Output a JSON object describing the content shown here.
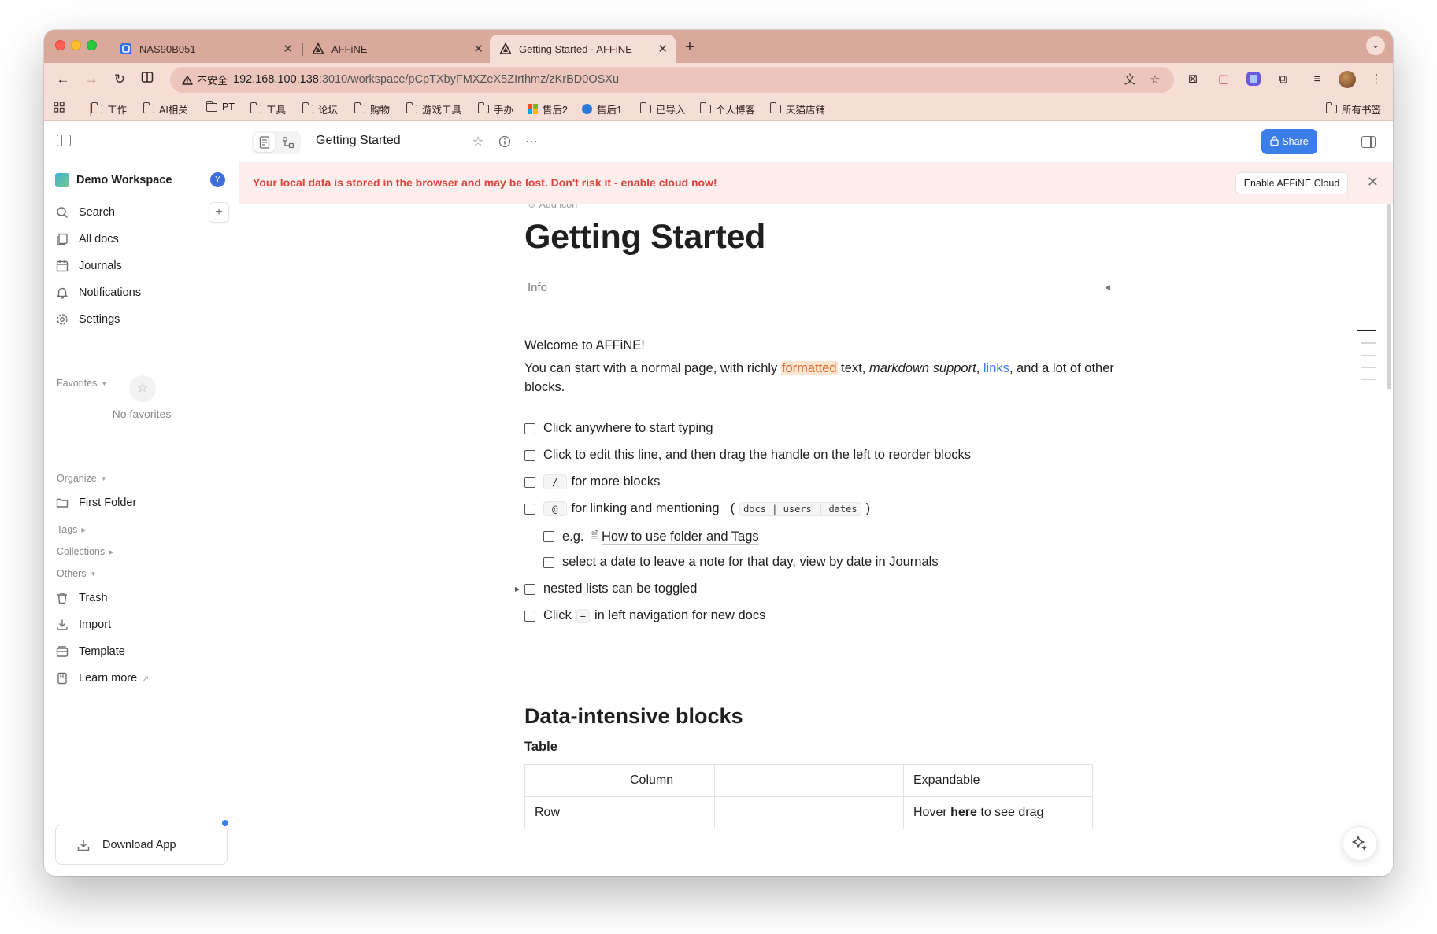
{
  "browser": {
    "tabs": [
      {
        "title": "NAS90B051",
        "favicon": "nas-favicon",
        "active": false
      },
      {
        "title": "AFFiNE",
        "favicon": "affine-favicon",
        "active": false
      },
      {
        "title": "Getting Started · AFFiNE",
        "favicon": "affine-favicon",
        "active": true
      }
    ],
    "security_label": "不安全",
    "url_host": "192.168.100.138",
    "url_rest": ":3010/workspace/pCpTXbyFMXZeX5ZIrthmz/zKrBD0OSXu",
    "bookmarks": [
      "工作",
      "AI相关",
      "PT",
      "工具",
      "论坛",
      "购物",
      "游戏工具",
      "手办",
      "售后2",
      "售后1",
      "已导入",
      "个人博客",
      "天猫店铺"
    ],
    "all_bookmarks": "所有书签",
    "theme_color": "#d9a99c"
  },
  "sidebar": {
    "workspace_name": "Demo Workspace",
    "workspace_avatar": "Y",
    "nav": [
      {
        "label": "Search",
        "icon": "search-icon"
      },
      {
        "label": "All docs",
        "icon": "docs-icon"
      },
      {
        "label": "Journals",
        "icon": "calendar-icon"
      },
      {
        "label": "Notifications",
        "icon": "bell-icon"
      },
      {
        "label": "Settings",
        "icon": "gear-icon"
      }
    ],
    "favorites_label": "Favorites",
    "no_favorites": "No favorites",
    "organize_label": "Organize",
    "folders": [
      "First Folder"
    ],
    "tags_label": "Tags",
    "collections_label": "Collections",
    "others_label": "Others",
    "others": [
      {
        "label": "Trash",
        "icon": "trash-icon"
      },
      {
        "label": "Import",
        "icon": "import-icon"
      },
      {
        "label": "Template",
        "icon": "template-icon"
      },
      {
        "label": "Learn more",
        "icon": "book-icon"
      }
    ],
    "download_label": "Download App"
  },
  "header": {
    "title": "Getting Started",
    "share_label": "Share",
    "accent_color": "#3c7ee8"
  },
  "banner": {
    "message": "Your local data is stored in the browser and may be lost. Don't risk it - enable cloud now!",
    "button": "Enable AFFiNE Cloud"
  },
  "doc": {
    "add_icon": "Add icon",
    "title": "Getting Started",
    "info_label": "Info",
    "welcome": "Welcome to AFFiNE!",
    "intro": {
      "p1": "You can start with a normal page, with richly ",
      "formatted": "formatted",
      "p2": " text, ",
      "italic": "markdown support",
      "p3": ", ",
      "link": "links",
      "p4": ", and a lot of other blocks."
    },
    "todos": {
      "t1": "Click anywhere to start typing",
      "t2": "Click to edit this line, and then drag the handle on the left to reorder blocks",
      "t3_code": "/",
      "t3": "for more blocks",
      "t4_code": "@",
      "t4": "for linking and mentioning",
      "t4_inline": "docs | users | dates",
      "t5_prefix": "e.g.",
      "t5_link": "How to use folder and Tags",
      "t6": "select a date to leave a note for that day, view by date in Journals",
      "t7": "nested lists can be toggled",
      "t8_a": "Click",
      "t8_code": "+",
      "t8_b": "in left navigation for new docs"
    },
    "h2": "Data-intensive blocks",
    "table_heading": "Table",
    "table": {
      "r1": [
        "",
        "Column",
        "",
        "",
        "Expandable"
      ],
      "r2_c1": "Row",
      "r2_c5_a": "Hover ",
      "r2_c5_bold": "here",
      "r2_c5_b": " to see drag"
    }
  }
}
